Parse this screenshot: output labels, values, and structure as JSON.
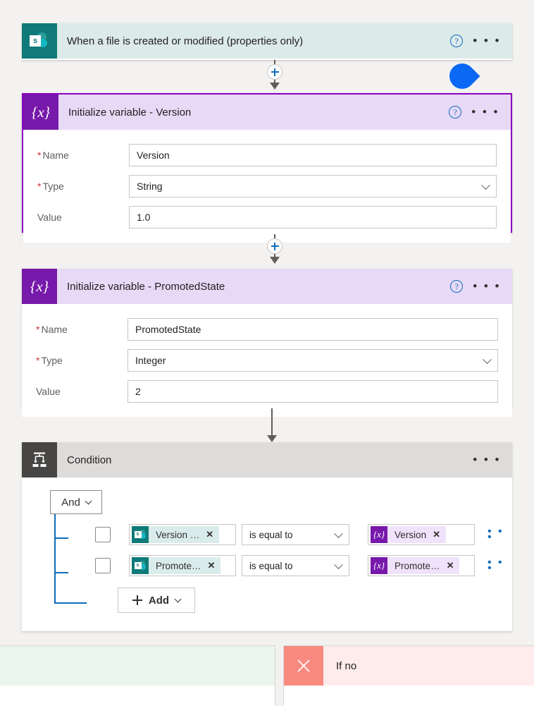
{
  "trigger": {
    "icon": "sharepoint-icon",
    "title": "When a file is created or modified (properties only)",
    "help_label": "?",
    "more_label": "• • •"
  },
  "actions": [
    {
      "icon": "variable-braces-icon",
      "title": "Initialize variable - Version",
      "selected": true,
      "help_label": "?",
      "more_label": "• • •",
      "fields": [
        {
          "label": "Name",
          "required": true,
          "value": "Version",
          "type": "text"
        },
        {
          "label": "Type",
          "required": true,
          "value": "String",
          "type": "select"
        },
        {
          "label": "Value",
          "required": false,
          "value": "1.0",
          "type": "text"
        }
      ]
    },
    {
      "icon": "variable-braces-icon",
      "title": "Initialize variable - PromotedState",
      "selected": false,
      "help_label": "?",
      "more_label": "• • •",
      "fields": [
        {
          "label": "Name",
          "required": true,
          "value": "PromotedState",
          "type": "text"
        },
        {
          "label": "Type",
          "required": true,
          "value": "Integer",
          "type": "select"
        },
        {
          "label": "Value",
          "required": false,
          "value": "2",
          "type": "text"
        }
      ]
    }
  ],
  "condition": {
    "icon": "condition-icon",
    "title": "Condition",
    "more_label": "• • •",
    "logic_operator": "And",
    "rows": [
      {
        "left_token": {
          "source": "sharepoint-icon",
          "label": "Version …",
          "remove_label": "✕"
        },
        "operator": "is equal to",
        "right_token": {
          "source": "variable-braces-icon",
          "label": "Version",
          "remove_label": "✕"
        },
        "more_label": "• • •"
      },
      {
        "left_token": {
          "source": "sharepoint-icon",
          "label": "Promote…",
          "remove_label": "✕"
        },
        "operator": "is equal to",
        "right_token": {
          "source": "variable-braces-icon",
          "label": "Promote…",
          "remove_label": "✕"
        },
        "more_label": "• • •"
      }
    ],
    "add_label": "Add"
  },
  "branches": {
    "yes": {
      "label": ""
    },
    "no": {
      "label": "If no",
      "icon": "close-x-icon"
    }
  },
  "tokens": {
    "braces_glyph": "{x}",
    "sharepoint_letter": "s"
  },
  "colors": {
    "sharepoint_teal": "#0f7a79",
    "variable_purple": "#7719aa",
    "selected_border": "#8a00c2",
    "condition_gray": "#484644",
    "accent_blue": "#0f6cbd",
    "yes_green": "#eaf6ed",
    "no_red": "#fdeceb",
    "no_tile": "#f98a7f",
    "cursor_blue": "#0a68f5"
  }
}
